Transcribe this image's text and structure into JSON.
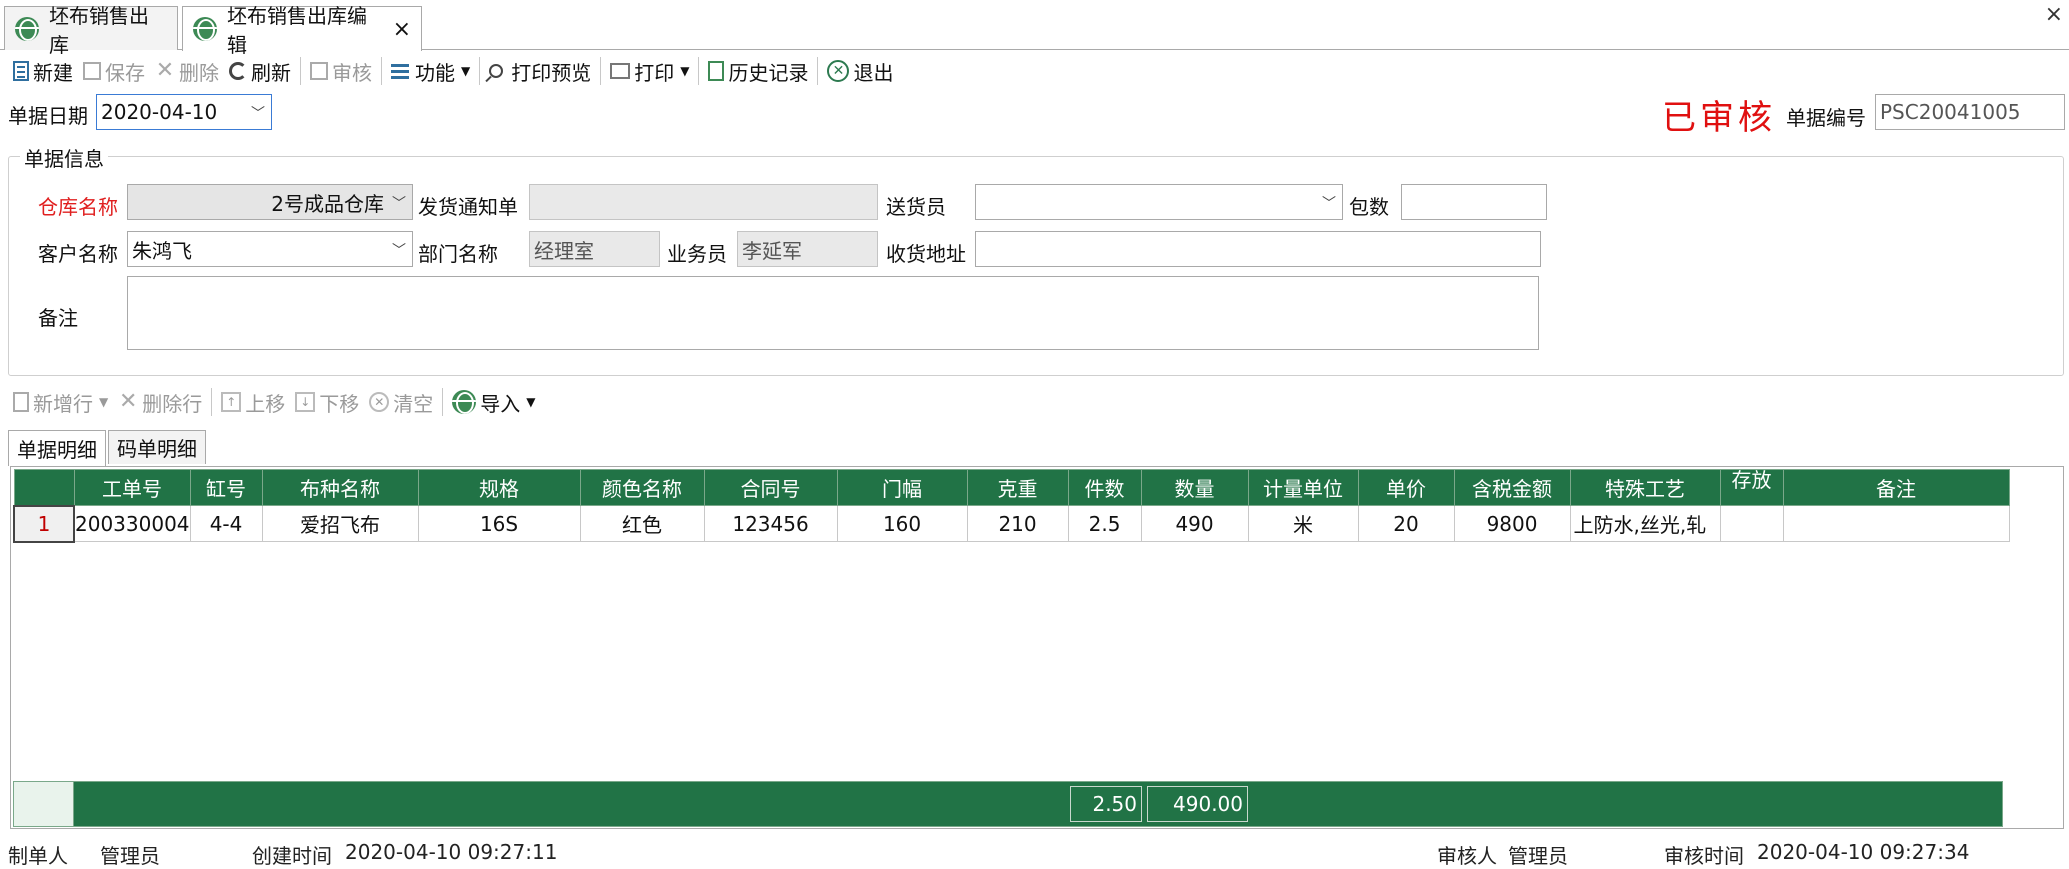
{
  "tabs": [
    {
      "label": "坯布销售出库"
    },
    {
      "label": "坯布销售出库编辑",
      "close": "×"
    }
  ],
  "window_close": "×",
  "toolbar": {
    "new": "新建",
    "save": "保存",
    "delete": "删除",
    "refresh": "刷新",
    "audit": "审核",
    "function": "功能",
    "print_preview": "打印预览",
    "print": "打印",
    "history": "历史记录",
    "exit": "退出"
  },
  "header": {
    "date_label": "单据日期",
    "date_value": "2020-04-10",
    "stamp": "已审核",
    "no_label": "单据编号",
    "no_value": "PSC20041005"
  },
  "info": {
    "group_title": "单据信息",
    "warehouse_label": "仓库名称",
    "warehouse_value": "2号成品仓库",
    "notice_label": "发货通知单",
    "notice_value": "",
    "delivery_label": "送货员",
    "delivery_value": "",
    "packages_label": "包数",
    "packages_value": "",
    "customer_label": "客户名称",
    "customer_value": "朱鸿飞",
    "dept_label": "部门名称",
    "dept_value": "经理室",
    "sales_label": "业务员",
    "sales_value": "李延军",
    "address_label": "收货地址",
    "address_value": "",
    "remark_label": "备注",
    "remark_value": ""
  },
  "detail_toolbar": {
    "add_row": "新增行",
    "delete_row": "删除行",
    "move_up": "上移",
    "move_down": "下移",
    "clear": "清空",
    "import": "导入"
  },
  "subtabs": [
    "单据明细",
    "码单明细"
  ],
  "grid": {
    "columns": [
      "工单号",
      "缸号",
      "布种名称",
      "规格",
      "颜色名称",
      "合同号",
      "门幅",
      "克重",
      "件数",
      "数量",
      "计量单位",
      "单价",
      "含税金额",
      "特殊工艺",
      "存放",
      "备注"
    ],
    "rows": [
      {
        "index": "1",
        "cells": [
          "200330004",
          "4-4",
          "爱招飞布",
          "16S",
          "红色",
          "123456",
          "160",
          "210",
          "2.5",
          "490",
          "米",
          "20",
          "9800",
          "上防水,丝光,轧",
          "",
          ""
        ]
      }
    ],
    "totals": {
      "pieces": "2.50",
      "quantity": "490.00"
    }
  },
  "status_bar": {
    "creator_label": "制单人",
    "creator_value": "管理员",
    "created_label": "创建时间",
    "created_value": "2020-04-10 09:27:11",
    "auditor_label": "审核人",
    "auditor_value": "管理员",
    "audited_label": "审核时间",
    "audited_value": "2020-04-10 09:27:34"
  }
}
